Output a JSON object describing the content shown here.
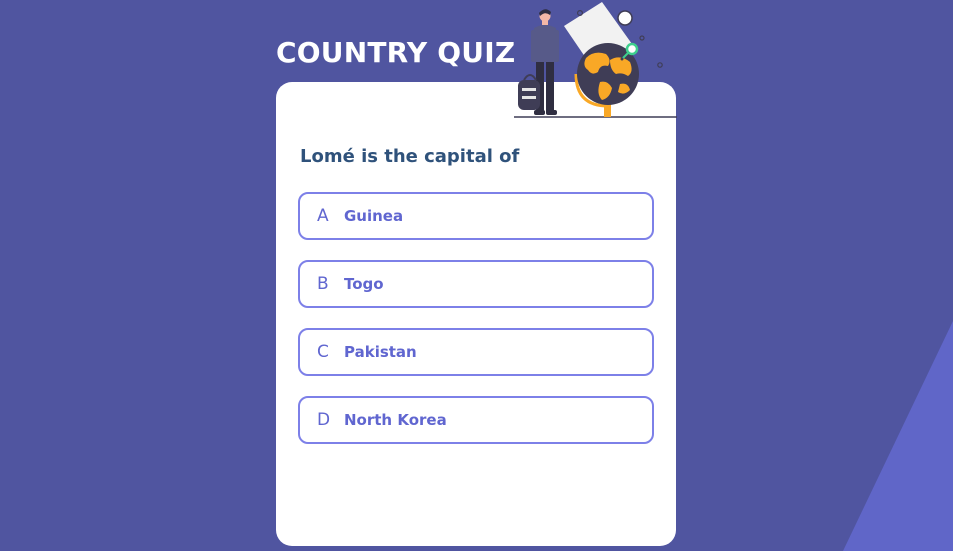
{
  "app": {
    "title": "COUNTRY QUIZ"
  },
  "quiz": {
    "question": "Lomé is the capital of",
    "options": [
      {
        "letter": "A",
        "text": "Guinea"
      },
      {
        "letter": "B",
        "text": "Togo"
      },
      {
        "letter": "C",
        "text": "Pakistan"
      },
      {
        "letter": "D",
        "text": "North Korea"
      }
    ]
  },
  "illustration": {
    "icon": "adventure-globe-illustration"
  },
  "colors": {
    "background": "#5055a0",
    "accent_shape": "#6066c8",
    "card": "#ffffff",
    "question_text": "#2f527b",
    "option_border": "#7d80e8",
    "option_text": "#6066d0",
    "globe_orange": "#f9a826"
  }
}
